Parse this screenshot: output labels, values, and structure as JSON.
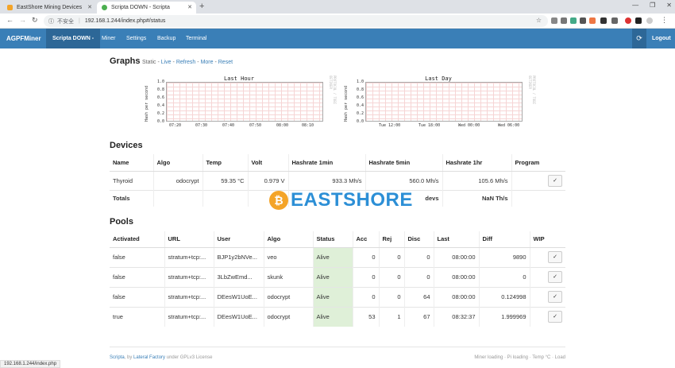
{
  "browser": {
    "tabs": [
      {
        "title": "EastShore Mining Devices",
        "active": false
      },
      {
        "title": "Scripta DOWN - Scripta",
        "active": true
      }
    ],
    "insecure_label": "不安全",
    "url": "192.168.1.244/index.php#/status",
    "status_url": "192.168.1.244/index.php"
  },
  "navbar": {
    "brand": "AGPFMiner",
    "items": [
      "Scripta DOWN -",
      "Miner",
      "Settings",
      "Backup",
      "Terminal"
    ],
    "logout": "Logout"
  },
  "graphs": {
    "heading": "Graphs",
    "links_prefix": "Static - ",
    "links": [
      "Live",
      "Refresh",
      "More",
      "Reset"
    ],
    "panels": [
      {
        "title": "Last Hour",
        "ylabel": "Hash per second",
        "yticks": [
          "1.0",
          "0.8",
          "0.6",
          "0.4",
          "0.2",
          "0.0"
        ],
        "xticks": [
          "07:20",
          "07:30",
          "07:40",
          "07:50",
          "08:00",
          "08:10"
        ],
        "side_text": "PROTOCOL / TOBI OETIKER"
      },
      {
        "title": "Last Day",
        "ylabel": "Hash per second",
        "yticks": [
          "1.0",
          "0.8",
          "0.6",
          "0.4",
          "0.2",
          "0.0"
        ],
        "xticks": [
          "Tue 12:00",
          "Tue 18:00",
          "Wed 00:00",
          "Wed 06:00"
        ],
        "side_text": "PROTOCOL / TOBI OETIKER"
      }
    ]
  },
  "devices": {
    "heading": "Devices",
    "columns": [
      "Name",
      "Algo",
      "Temp",
      "Volt",
      "Hashrate 1min",
      "Hashrate 5min",
      "Hashrate 1hr",
      "Program"
    ],
    "rows": [
      {
        "name": "Thyroid",
        "algo": "odocrypt",
        "temp": "59.35 °C",
        "volt": "0.979 V",
        "h1": "933.3 Mh/s",
        "h5": "560.0 Mh/s",
        "h1hr": "105.6 Mh/s",
        "program": "✓"
      }
    ],
    "totals_label": "Totals",
    "totals_devs": "devs",
    "totals_rate": "NaN Th/s"
  },
  "pools": {
    "heading": "Pools",
    "columns": [
      "Activated",
      "URL",
      "User",
      "Algo",
      "Status",
      "Acc",
      "Rej",
      "Disc",
      "Last",
      "Diff",
      "WIP"
    ],
    "rows": [
      {
        "activated": "false",
        "url": "stratum+tcp:...",
        "user": "BJP1y2bNVe...",
        "algo": "veo",
        "status": "Alive",
        "acc": "0",
        "rej": "0",
        "disc": "0",
        "last": "08:00:00",
        "diff": "9890",
        "wip": "✓"
      },
      {
        "activated": "false",
        "url": "stratum+tcp:...",
        "user": "3LbZwEmd...",
        "algo": "skunk",
        "status": "Alive",
        "acc": "0",
        "rej": "0",
        "disc": "0",
        "last": "08:00:00",
        "diff": "0",
        "wip": "✓"
      },
      {
        "activated": "false",
        "url": "stratum+tcp:...",
        "user": "DEesW1UoE...",
        "algo": "odocrypt",
        "status": "Alive",
        "acc": "0",
        "rej": "0",
        "disc": "64",
        "last": "08:00:00",
        "diff": "0.124998",
        "wip": "✓"
      },
      {
        "activated": "true",
        "url": "stratum+tcp:...",
        "user": "DEesW1UoE...",
        "algo": "odocrypt",
        "status": "Alive",
        "acc": "53",
        "rej": "1",
        "disc": "67",
        "last": "08:32:37",
        "diff": "1.999969",
        "wip": "✓"
      }
    ]
  },
  "footer": {
    "scripta": "Scripta",
    "by": ", by ",
    "company": "Lateral Factory",
    "license": " under GPLv3 License",
    "right": "Miner loading · Pi loading · Temp °C · Load"
  },
  "watermark": {
    "coin": "₿",
    "text": "EASTSHORE"
  },
  "colors": {
    "navbar": "#3a7fb7",
    "alive": "#dff0d8",
    "link": "#3a7fb7"
  }
}
